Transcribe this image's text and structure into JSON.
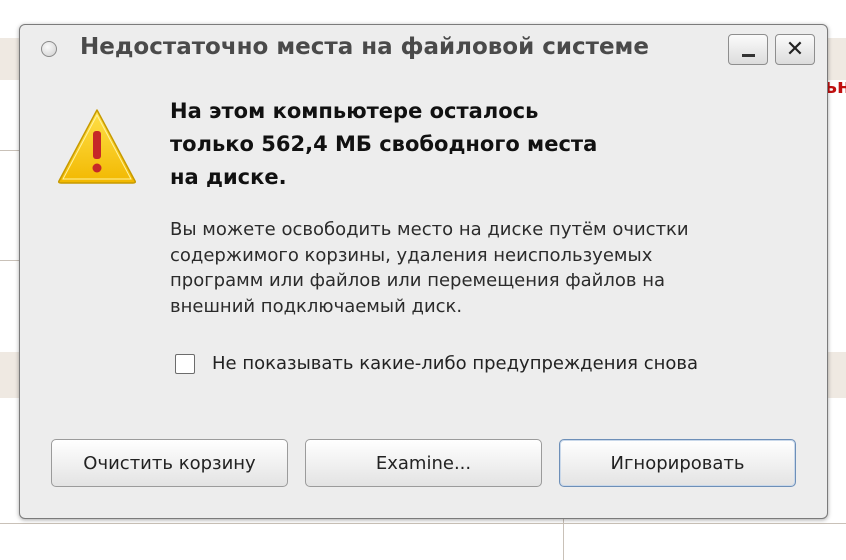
{
  "dialog": {
    "title": "Недостаточно места на файловой системе",
    "headline_lines": [
      "На этом компьютере осталось",
      "только 562,4 МБ свободного места",
      "на диске."
    ],
    "body_lines": [
      "Вы можете освободить место на диске путём очистки",
      "содержимого корзины, удаления неиспользуемых",
      "программ или файлов или перемещения файлов на",
      "внешний подключаемый диск."
    ],
    "checkbox": {
      "label": "Не показывать какие-либо предупреждения снова",
      "checked": false
    },
    "buttons": {
      "empty_trash": "Очистить корзину",
      "examine": "Examine...",
      "ignore": "Игнорировать"
    },
    "window_controls": {
      "minimize_icon": "minimize-icon",
      "close_icon": "close-icon",
      "close_glyph": "✕"
    },
    "icon": "warning-icon"
  },
  "background": {
    "fragment_text": "ън"
  },
  "colors": {
    "dialog_bg": "#ededed",
    "warning_fill": "#f5c400",
    "warning_mark": "#c62828"
  }
}
